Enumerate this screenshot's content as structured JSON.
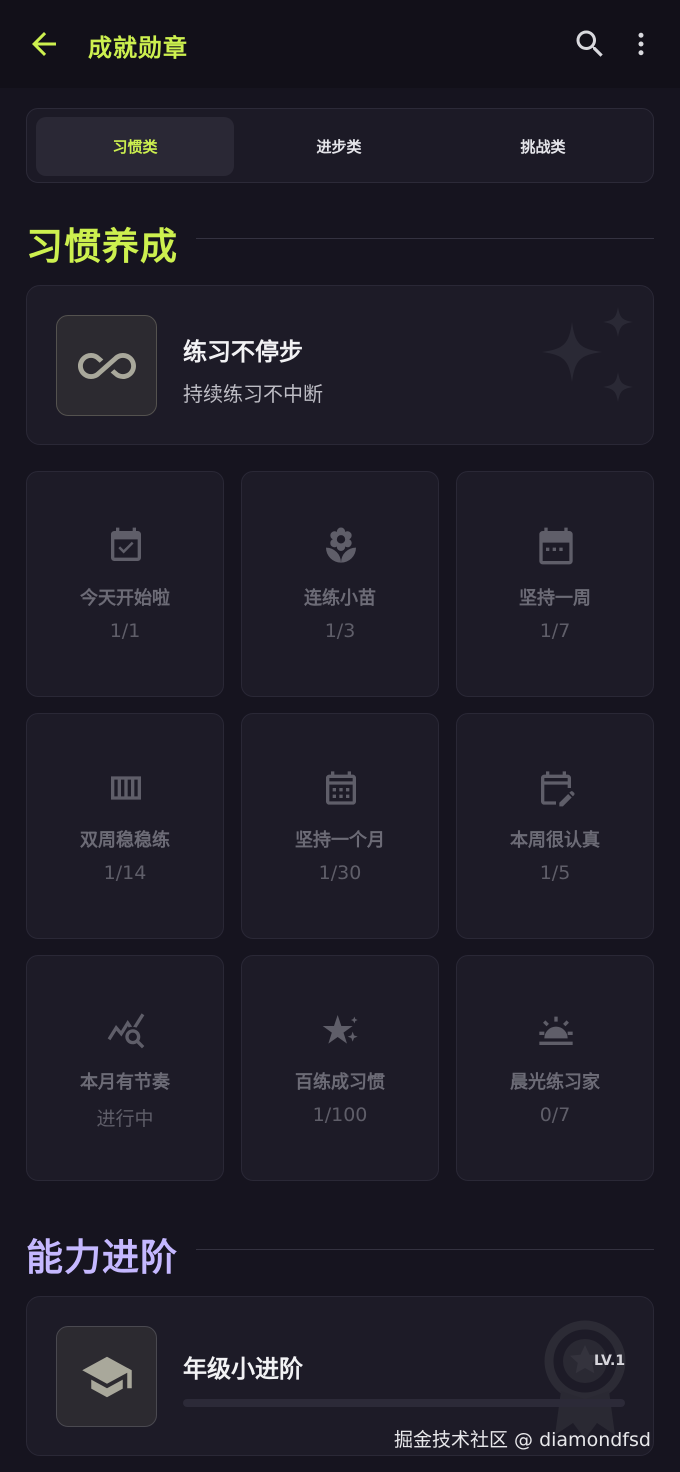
{
  "header": {
    "title": "成就勋章",
    "back_icon": "arrow-left-icon",
    "search_icon": "search-icon",
    "more_icon": "more-vert-icon"
  },
  "tabs": [
    {
      "label": "习惯类",
      "active": true
    },
    {
      "label": "进步类",
      "active": false
    },
    {
      "label": "挑战类",
      "active": false
    }
  ],
  "habit_section": {
    "title": "习惯养成",
    "featured": {
      "title": "练习不停步",
      "subtitle": "持续练习不中断",
      "icon": "infinity-icon",
      "decoration": "sparkle-icon"
    },
    "badges": [
      {
        "name": "今天开始啦",
        "progress": "1/1",
        "icon": "calendar-check-icon"
      },
      {
        "name": "连练小苗",
        "progress": "1/3",
        "icon": "flower-icon"
      },
      {
        "name": "坚持一周",
        "progress": "1/7",
        "icon": "calendar-week-icon"
      },
      {
        "name": "双周稳稳练",
        "progress": "1/14",
        "icon": "view-week-icon"
      },
      {
        "name": "坚持一个月",
        "progress": "1/30",
        "icon": "calendar-month-icon"
      },
      {
        "name": "本周很认真",
        "progress": "1/5",
        "icon": "edit-calendar-icon"
      },
      {
        "name": "本月有节奏",
        "progress": "进行中",
        "icon": "query-stats-icon"
      },
      {
        "name": "百练成习惯",
        "progress": "1/100",
        "icon": "star-sparkle-icon"
      },
      {
        "name": "晨光练习家",
        "progress": "0/7",
        "icon": "sunrise-icon"
      }
    ]
  },
  "ability_section": {
    "title": "能力进阶",
    "featured": {
      "title": "年级小进阶",
      "level": "LV.1",
      "icon": "graduation-cap-icon",
      "decoration": "medal-icon",
      "progress": 0
    }
  },
  "watermark": "掘金技术社区 @ diamondfsd",
  "colors": {
    "accent": "#cdf04f",
    "ability": "#c5b8ff",
    "background": "#16141f",
    "card": "#1d1b27"
  }
}
